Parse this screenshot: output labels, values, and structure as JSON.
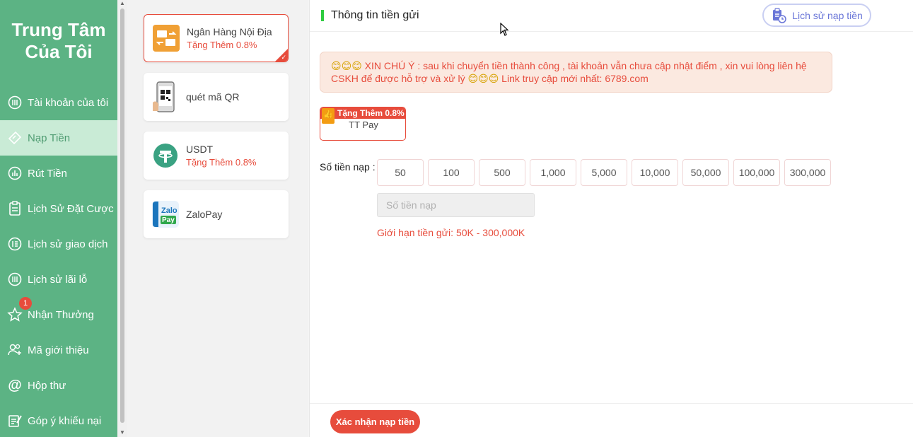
{
  "sidebar": {
    "brand_line1": "Trung Tâm",
    "brand_line2": "Của Tôi",
    "items": [
      {
        "label": "Tài khoản của tôi",
        "icon": "account-icon"
      },
      {
        "label": "Nạp Tiền",
        "icon": "deposit-ticket-icon",
        "active": true
      },
      {
        "label": "Rút Tiền",
        "icon": "withdraw-chart-icon"
      },
      {
        "label": "Lịch Sử Đặt Cược",
        "icon": "clipboard-icon"
      },
      {
        "label": "Lịch sử giao dịch",
        "icon": "list-icon"
      },
      {
        "label": "Lịch sử lãi lỗ",
        "icon": "profit-loss-icon"
      },
      {
        "label": "Nhận Thưởng",
        "icon": "star-icon",
        "badge": "1"
      },
      {
        "label": "Mã giới thiệu",
        "icon": "referral-icon"
      },
      {
        "label": "Hộp thư",
        "icon": "at-icon"
      },
      {
        "label": "Góp ý khiếu nại",
        "icon": "feedback-icon"
      }
    ]
  },
  "methods": [
    {
      "name": "Ngân Hàng Nội Địa",
      "bonus": "Tặng Thêm 0.8%",
      "icon": "bank-transfer-icon",
      "selected": true
    },
    {
      "name": "quét mã QR",
      "bonus": "",
      "icon": "qr-phone-icon"
    },
    {
      "name": "USDT",
      "bonus": "Tặng Thêm 0.8%",
      "icon": "tether-icon"
    },
    {
      "name": "ZaloPay",
      "bonus": "",
      "icon": "zalopay-icon"
    }
  ],
  "main": {
    "title": "Thông tin tiền gửi",
    "history_button": "Lịch sử nạp tiền",
    "notice_emoji": "😊😊😊",
    "notice_text1": " XIN CHÚ Ý : sau khi chuyển tiền thành công , tài khoản vẫn chưa cập nhật điểm , xin vui lòng liên hệ CSKH để được hỗ trợ và xử lý ",
    "notice_text2": " Link truy cập mới nhất: 6789.com",
    "channel_tag": "Tặng Thêm 0.8%",
    "channel_name": "TT Pay",
    "amount_label": "Số tiền nạp :",
    "amounts": [
      "50",
      "100",
      "500",
      "1,000",
      "5,000",
      "10,000",
      "50,000",
      "100,000",
      "300,000"
    ],
    "amount_placeholder": "Số tiền nạp",
    "limit_text": "Giới hạn tiền gửi:  50K  -  300,000K",
    "confirm_button": "Xác nhận nạp tiền"
  },
  "colors": {
    "sidebar": "#5cb384",
    "accent_red": "#e74c3c",
    "history_blue": "#6a76d8"
  }
}
